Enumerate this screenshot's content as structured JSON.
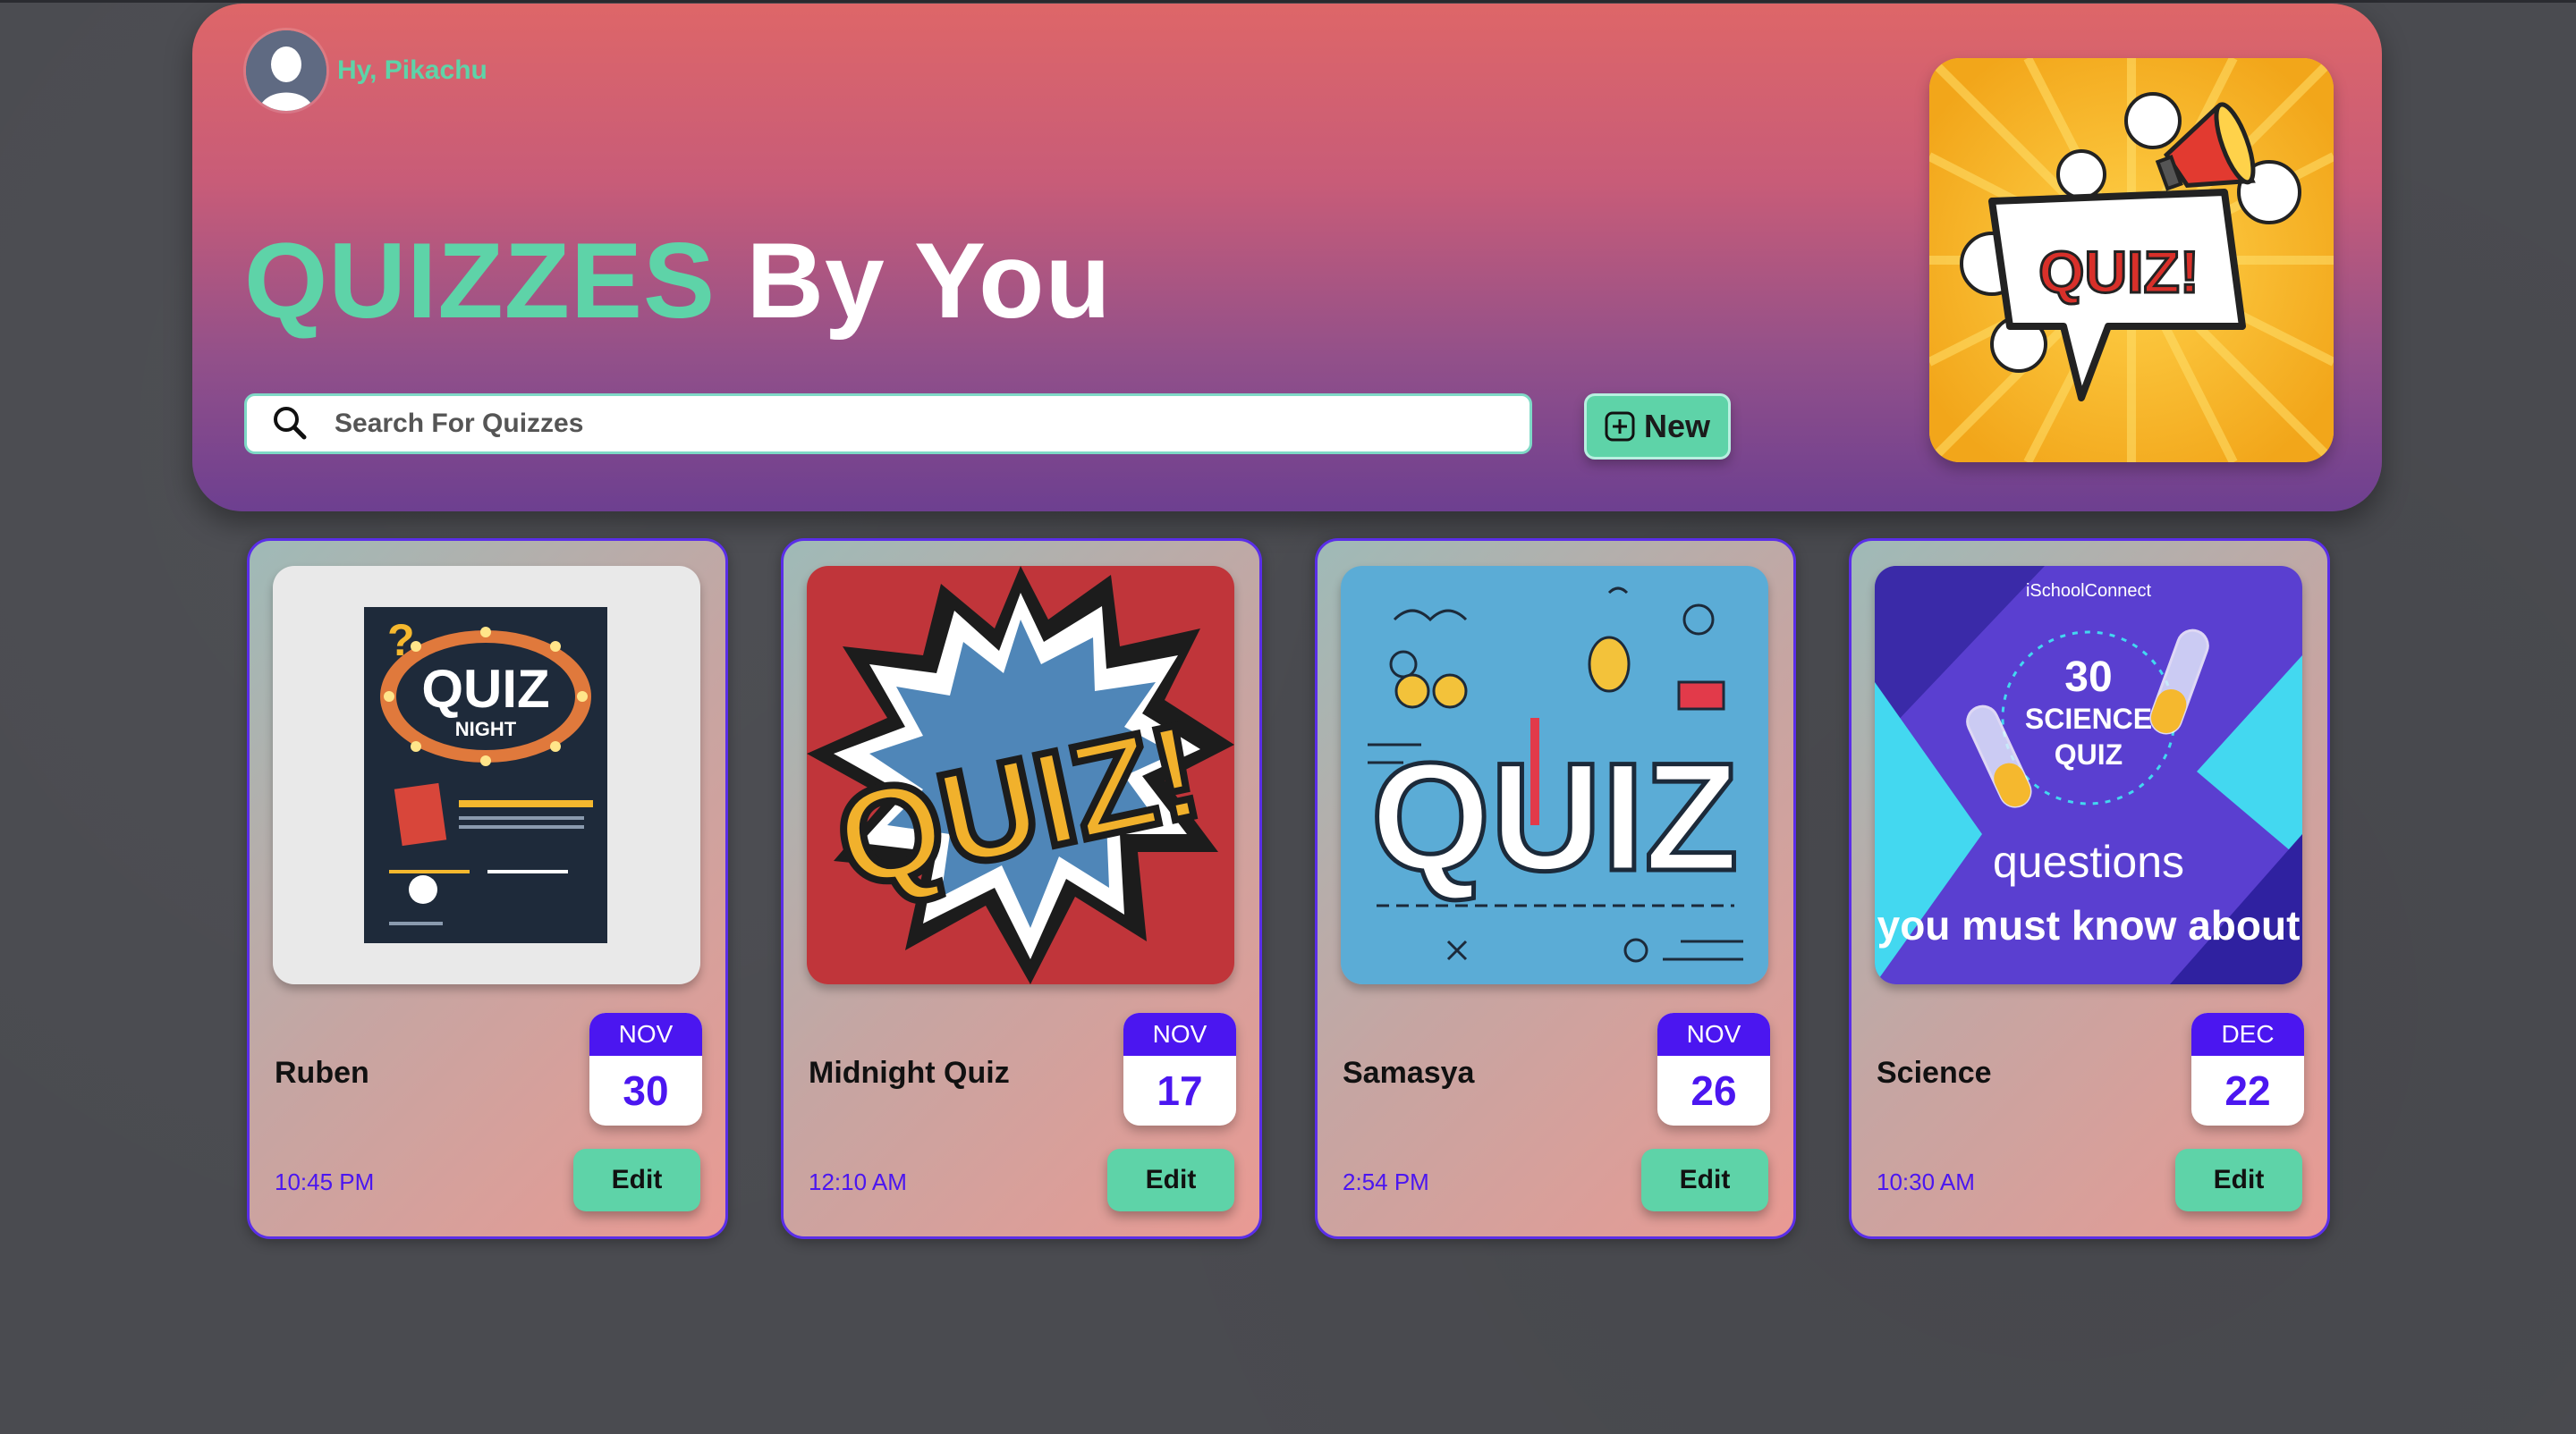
{
  "user": {
    "greeting": "Hy, Pikachu"
  },
  "header": {
    "title_accent": "QUIZZES",
    "title_rest": "By You",
    "search_placeholder": "Search For Quizzes",
    "new_label": "New",
    "hero_text": "QUIZ!"
  },
  "quizzes": [
    {
      "name": "Ruben",
      "month": "NOV",
      "day": "30",
      "time": "10:45 PM",
      "edit_label": "Edit",
      "thumb_text": "QUIZ",
      "thumb_sub": "NIGHT"
    },
    {
      "name": "Midnight Quiz",
      "month": "NOV",
      "day": "17",
      "time": "12:10 AM",
      "edit_label": "Edit",
      "thumb_text": "QUIZ!"
    },
    {
      "name": "Samasya",
      "month": "NOV",
      "day": "26",
      "time": "2:54 PM",
      "edit_label": "Edit",
      "thumb_text": "QUIZ"
    },
    {
      "name": "Science",
      "month": "DEC",
      "day": "22",
      "time": "10:30 AM",
      "edit_label": "Edit",
      "thumb_brand": "iSchoolConnect",
      "thumb_line1": "30",
      "thumb_line2": "SCIENCE",
      "thumb_line3": "QUIZ",
      "thumb_line4": "questions",
      "thumb_line5": "you must know about"
    }
  ],
  "colors": {
    "accent_green": "#5ed3a8",
    "date_purple": "#4b16f0",
    "background": "#4a4b50"
  }
}
